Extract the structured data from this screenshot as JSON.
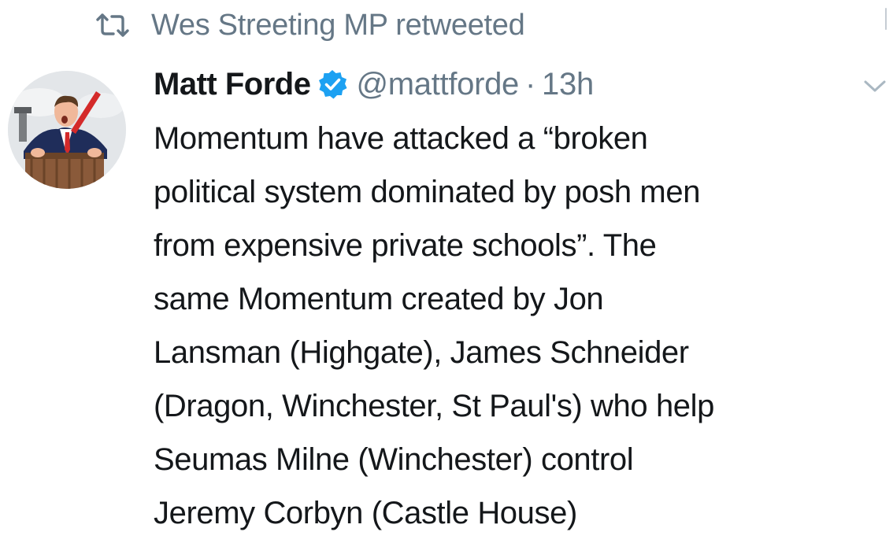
{
  "retweet": {
    "icon": "retweet-icon",
    "label": "Wes Streeting MP retweeted"
  },
  "tweet": {
    "author": {
      "name": "Matt Forde",
      "handle": "@mattforde",
      "verified_icon": "verified-badge-icon",
      "avatar": "profile-avatar"
    },
    "separator": "·",
    "timestamp": "13h",
    "menu_icon": "chevron-down-icon",
    "text": "Momentum have attacked a “broken\npolitical system dominated by posh men\nfrom expensive private schools”. The\nsame Momentum created by Jon\nLansman (Highgate), James Schneider\n(Dragon, Winchester, St Paul's) who help\nSeumas Milne (Winchester) control\nJeremy Corbyn (Castle House)"
  },
  "colors": {
    "text_primary": "#14171a",
    "text_secondary": "#657786",
    "verified_blue": "#1da1f2",
    "background": "#ffffff"
  }
}
